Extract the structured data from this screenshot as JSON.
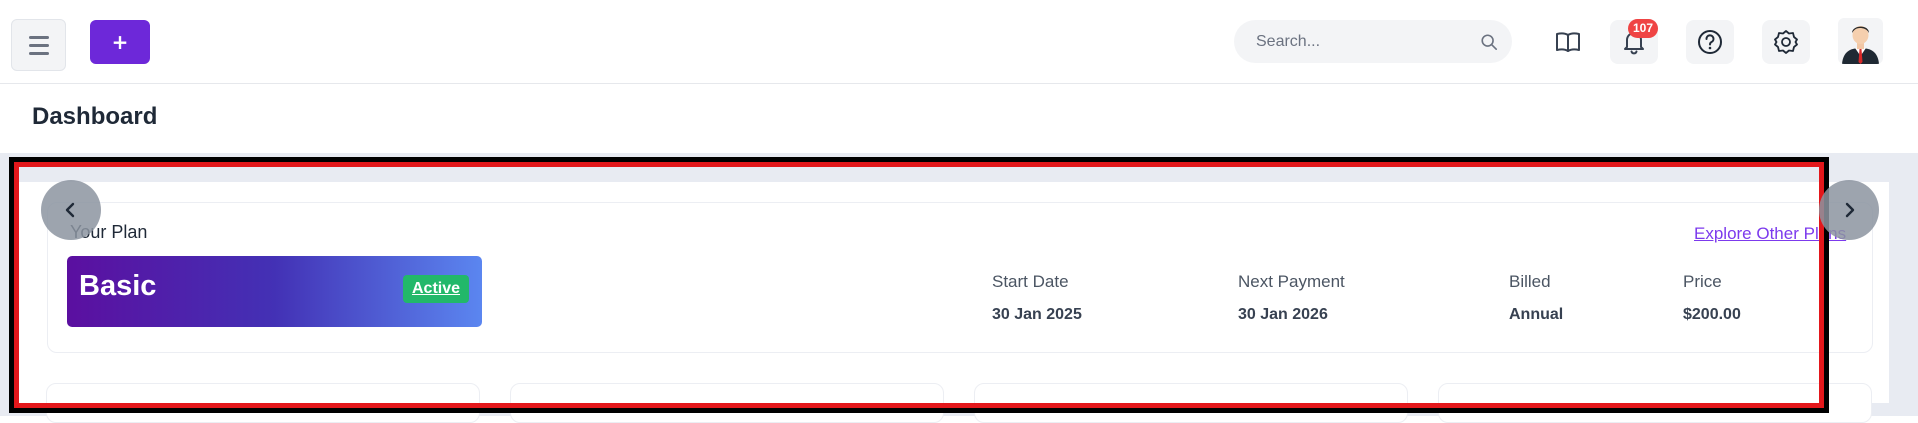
{
  "topbar": {
    "add_label": "+",
    "search": {
      "placeholder": "Search..."
    },
    "notifications": {
      "count": "107"
    },
    "icons": [
      "menu-icon",
      "book-icon",
      "bell-icon",
      "help-icon",
      "gear-icon",
      "avatar"
    ]
  },
  "page": {
    "title": "Dashboard"
  },
  "plan": {
    "section_label": "Your Plan",
    "explore_link": "Explore Other Plans",
    "name": "Basic",
    "status": "Active",
    "details": [
      {
        "label": "Start Date",
        "value": "30 Jan 2025"
      },
      {
        "label": "Next Payment",
        "value": "30 Jan 2026"
      },
      {
        "label": "Billed",
        "value": "Annual"
      },
      {
        "label": "Price",
        "value": "$200.00"
      }
    ]
  },
  "colors": {
    "accent": "#6d28d9",
    "badge": "#ef4444",
    "active": "#22b86a",
    "link": "#7c3aed",
    "highlight": "#e3171b"
  }
}
